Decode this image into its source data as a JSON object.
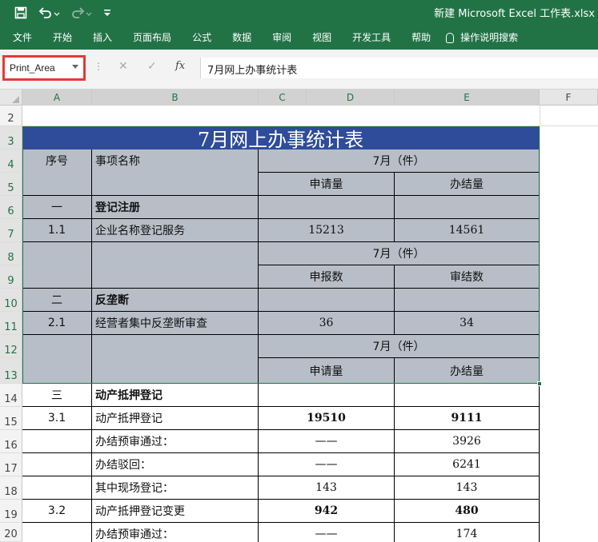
{
  "window_title": "新建 Microsoft Excel 工作表.xlsx",
  "quick_access": [
    "save-icon",
    "undo-icon",
    "redo-icon",
    "customize-icon"
  ],
  "ribbon_tabs": [
    "文件",
    "开始",
    "插入",
    "页面布局",
    "公式",
    "数据",
    "审阅",
    "视图",
    "开发工具",
    "帮助"
  ],
  "tell_me": "操作说明搜索",
  "name_box": "Print_Area",
  "formula": "7月网上办事统计表",
  "formula_buttons": {
    "cancel": "✕",
    "enter": "✓",
    "fx": "fx"
  },
  "columns": [
    "A",
    "B",
    "C",
    "D",
    "E",
    "F"
  ],
  "rows": [
    "2",
    "3",
    "4",
    "5",
    "6",
    "7",
    "8",
    "9",
    "10",
    "11",
    "12",
    "13",
    "14",
    "15",
    "16",
    "17",
    "18",
    "19",
    "20"
  ],
  "title": "7月网上办事统计表",
  "header": {
    "seq": "序号",
    "item": "事项名称",
    "month": "7月（件）",
    "apply": "申请量",
    "done": "办结量",
    "report": "申报数",
    "review": "审结数"
  },
  "sections": [
    {
      "num": "一",
      "name": "登记注册"
    },
    {
      "num": "1.1",
      "name": "企业名称登记服务",
      "v1": "15213",
      "v2": "14561"
    },
    {
      "num": "二",
      "name": "反垄断"
    },
    {
      "num": "2.1",
      "name": "经营者集中反垄断审查",
      "v1": "36",
      "v2": "34"
    },
    {
      "num": "三",
      "name": "动产抵押登记"
    },
    {
      "num": "3.1",
      "name": "动产抵押登记",
      "v1": "19510",
      "v2": "9111"
    },
    {
      "name": "办结预审通过：",
      "v1": "——",
      "v2": "3926"
    },
    {
      "name": "办结驳回：",
      "v1": "——",
      "v2": "6241"
    },
    {
      "name": "其中现场登记：",
      "v1": "143",
      "v2": "143"
    },
    {
      "num": "3.2",
      "name": "动产抵押登记变更",
      "v1": "942",
      "v2": "480"
    },
    {
      "name": "办结预审通过：",
      "v1": "——",
      "v2": "174"
    }
  ]
}
